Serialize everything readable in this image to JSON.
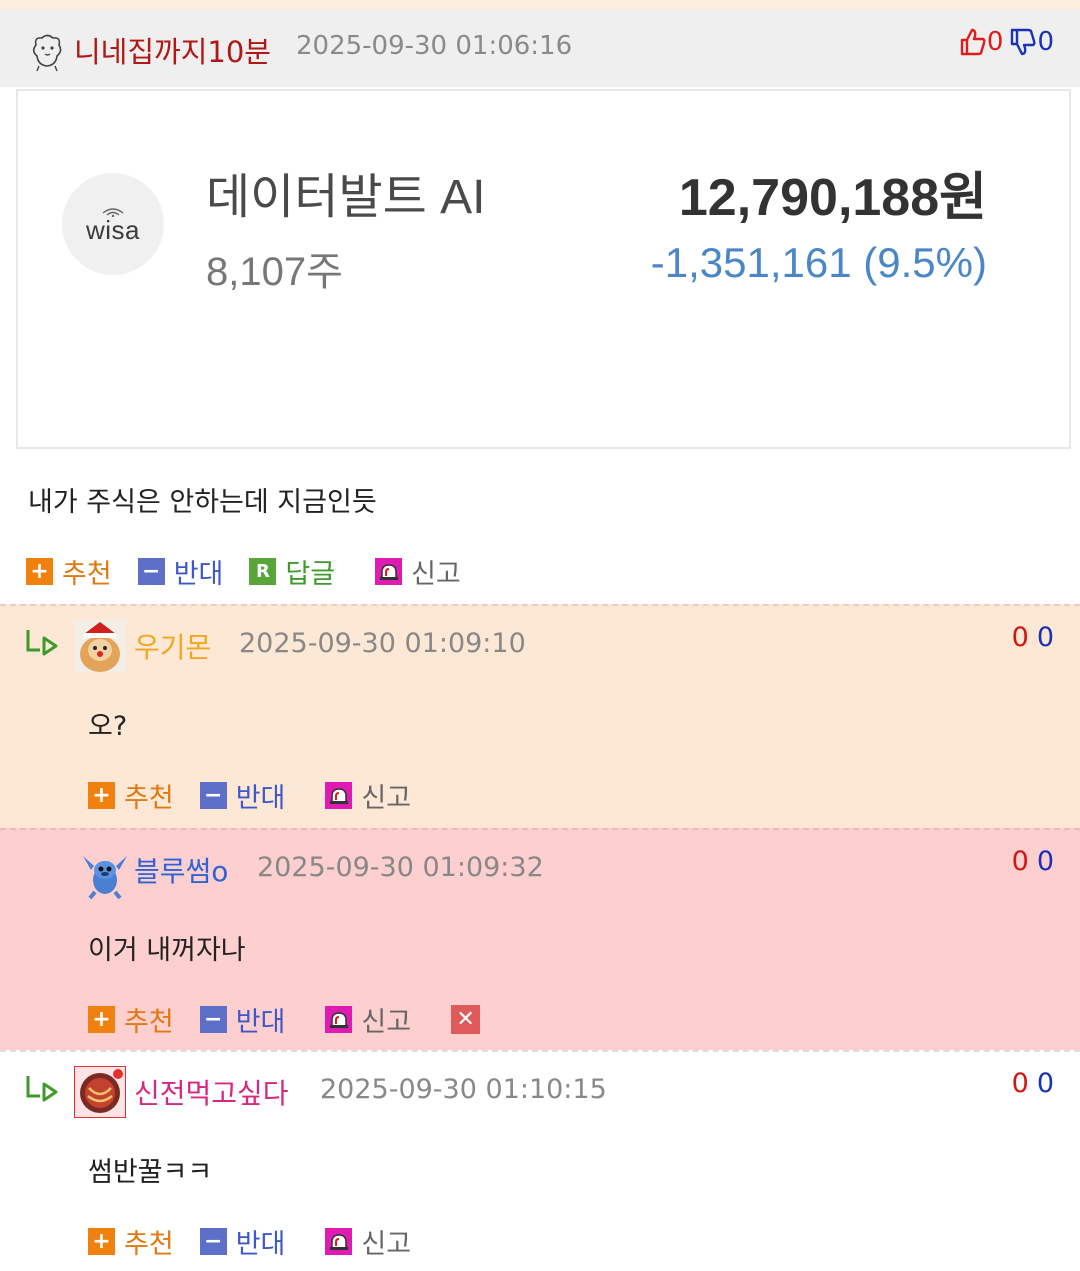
{
  "post": {
    "author": "니네집까지10분",
    "time": "2025-09-30 01:06:16",
    "likes": "0",
    "dislikes": "0",
    "body": "내가 주식은 안하는데 지금인듯"
  },
  "stock_card": {
    "logo_text": "wisa",
    "name": "데이터발트 AI",
    "shares": "8,107주",
    "value": "12,790,188원",
    "change": "-1,351,161 (9.5%)"
  },
  "actions": {
    "recommend": "추천",
    "oppose": "반대",
    "reply": "답글",
    "report": "신고",
    "recommend_icon": "+",
    "oppose_icon": "−",
    "reply_icon": "R",
    "delete_icon": "✕"
  },
  "comments": [
    {
      "author": "우기몬",
      "author_color": "#f2a61c",
      "time": "2025-09-30 01:09:10",
      "likes": "0",
      "dislikes": "0",
      "text": "오?"
    },
    {
      "author": "블루썸o",
      "author_color": "#2f63d6",
      "time": "2025-09-30 01:09:32",
      "likes": "0",
      "dislikes": "0",
      "text": "이거 내꺼자나"
    },
    {
      "author": "신전먹고싶다",
      "author_color": "#d7277e",
      "time": "2025-09-30 01:10:15",
      "likes": "0",
      "dislikes": "0",
      "text": "썸반꿀ㅋㅋ"
    }
  ],
  "icons": {
    "author_icon": "hamster-doodle-icon",
    "thumbs_up": "thumbs-up-icon",
    "thumbs_down": "thumbs-down-icon",
    "reply_arrow": "reply-arrow-icon",
    "report": "siren-icon",
    "delete": "close-icon"
  },
  "colors": {
    "recommend": "#f0810f",
    "oppose": "#5d6fc9",
    "reply": "#58a63a",
    "report": "#e01bb3",
    "stock_change": "#4a86c8"
  }
}
